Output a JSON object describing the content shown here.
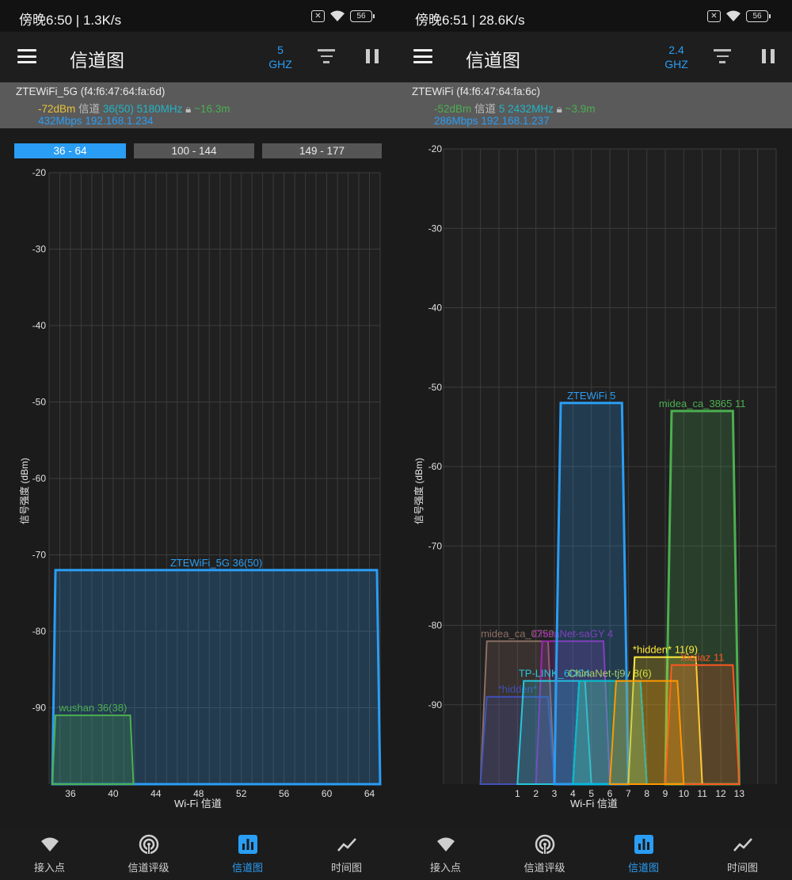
{
  "left": {
    "status": {
      "text": "傍晚6:50 | 1.3K/s",
      "battery": "56"
    },
    "title": "信道图",
    "band": {
      "value": "5",
      "unit": "GHZ"
    },
    "info": {
      "ssid": "ZTEWiFi_5G (f4:f6:47:64:fa:6d)",
      "dbm": "-72dBm",
      "channel_label": "信道",
      "channel": "36(50)",
      "freq": "5180MHz",
      "distance": "~16.3m",
      "speed": "432Mbps",
      "ip": "192.168.1.234"
    },
    "tabs": [
      "36 - 64",
      "100 - 144",
      "149 - 177"
    ],
    "chart_data": {
      "type": "area",
      "xlabel": "Wi-Fi 信道",
      "ylabel": "信号强度 (dBm)",
      "ylim": [
        -100,
        -20
      ],
      "xlim": [
        34,
        65
      ],
      "yticks": [
        -20,
        -30,
        -40,
        -50,
        -60,
        -70,
        -80,
        -90
      ],
      "xticks": [
        36,
        40,
        44,
        48,
        52,
        56,
        60,
        64
      ],
      "grid": true,
      "series": [
        {
          "name": "ZTEWiFi_5G 36(50)",
          "color": "#2a9df4",
          "x_start": 34.3,
          "x_end": 65,
          "level": -72
        },
        {
          "name": "wushan 36(38)",
          "color": "#4caf50",
          "x_start": 34.3,
          "x_end": 41.9,
          "level": -91
        }
      ]
    },
    "nav": [
      {
        "label": "接入点",
        "icon": "wifi-icon"
      },
      {
        "label": "信道评级",
        "icon": "signal-rating-icon"
      },
      {
        "label": "信道图",
        "icon": "bar-chart-icon"
      },
      {
        "label": "时间图",
        "icon": "line-chart-icon"
      }
    ]
  },
  "right": {
    "status": {
      "text": "傍晚6:51 | 28.6K/s",
      "battery": "56"
    },
    "title": "信道图",
    "band": {
      "value": "2.4",
      "unit": "GHZ"
    },
    "info": {
      "ssid": "ZTEWiFi (f4:f6:47:64:fa:6c)",
      "dbm": "-52dBm",
      "channel_label": "信道",
      "channel": "5",
      "freq": "2432MHz",
      "distance": "~3.9m",
      "speed": "286Mbps",
      "ip": "192.168.1.237"
    },
    "chart_data": {
      "type": "area",
      "xlabel": "Wi-Fi 信道",
      "ylabel": "信号强度 (dBm)",
      "ylim": [
        -100,
        -20
      ],
      "xlim": [
        -3,
        15
      ],
      "yticks": [
        -20,
        -30,
        -40,
        -50,
        -60,
        -70,
        -80,
        -90
      ],
      "xticks": [
        1,
        2,
        3,
        4,
        5,
        6,
        7,
        8,
        9,
        10,
        11,
        12,
        13
      ],
      "grid": true,
      "series": [
        {
          "name": "midea_ca_0759",
          "color": "#8d6e63",
          "channel": 1,
          "level": -82
        },
        {
          "name": "ChinaNet-saGY 4",
          "color": "#9c27b0",
          "channel": 4,
          "level": -82
        },
        {
          "name": "*hidden*",
          "color": "#3f51b5",
          "channel": 1,
          "level": -89
        },
        {
          "name": "TP-LINK_6DC4",
          "color": "#26c6da",
          "channel": 3,
          "level": -87
        },
        {
          "name": "ChinaNet-tj9v 8(6)",
          "color": "#cddc39",
          "channel": 6,
          "level": -87
        },
        {
          "name": "ZTEWiFi 5",
          "color": "#2a9df4",
          "channel": 5,
          "level": -52
        },
        {
          "name": "midea_ca_3865 11",
          "color": "#4caf50",
          "channel": 11,
          "level": -53
        },
        {
          "name": "*hidden* 11(9)",
          "color": "#ffeb3b",
          "channel": 9,
          "level": -84
        },
        {
          "name": "Xiejiaz 11",
          "color": "#ff5722",
          "channel": 11,
          "level": -85
        },
        {
          "name": "",
          "color": "#00bcd4",
          "channel": 6,
          "level": -87
        },
        {
          "name": "",
          "color": "#ff9800",
          "channel": 8,
          "level": -87
        }
      ]
    },
    "nav": [
      {
        "label": "接入点",
        "icon": "wifi-icon"
      },
      {
        "label": "信道评级",
        "icon": "signal-rating-icon"
      },
      {
        "label": "信道图",
        "icon": "bar-chart-icon"
      },
      {
        "label": "时间图",
        "icon": "line-chart-icon"
      }
    ]
  }
}
